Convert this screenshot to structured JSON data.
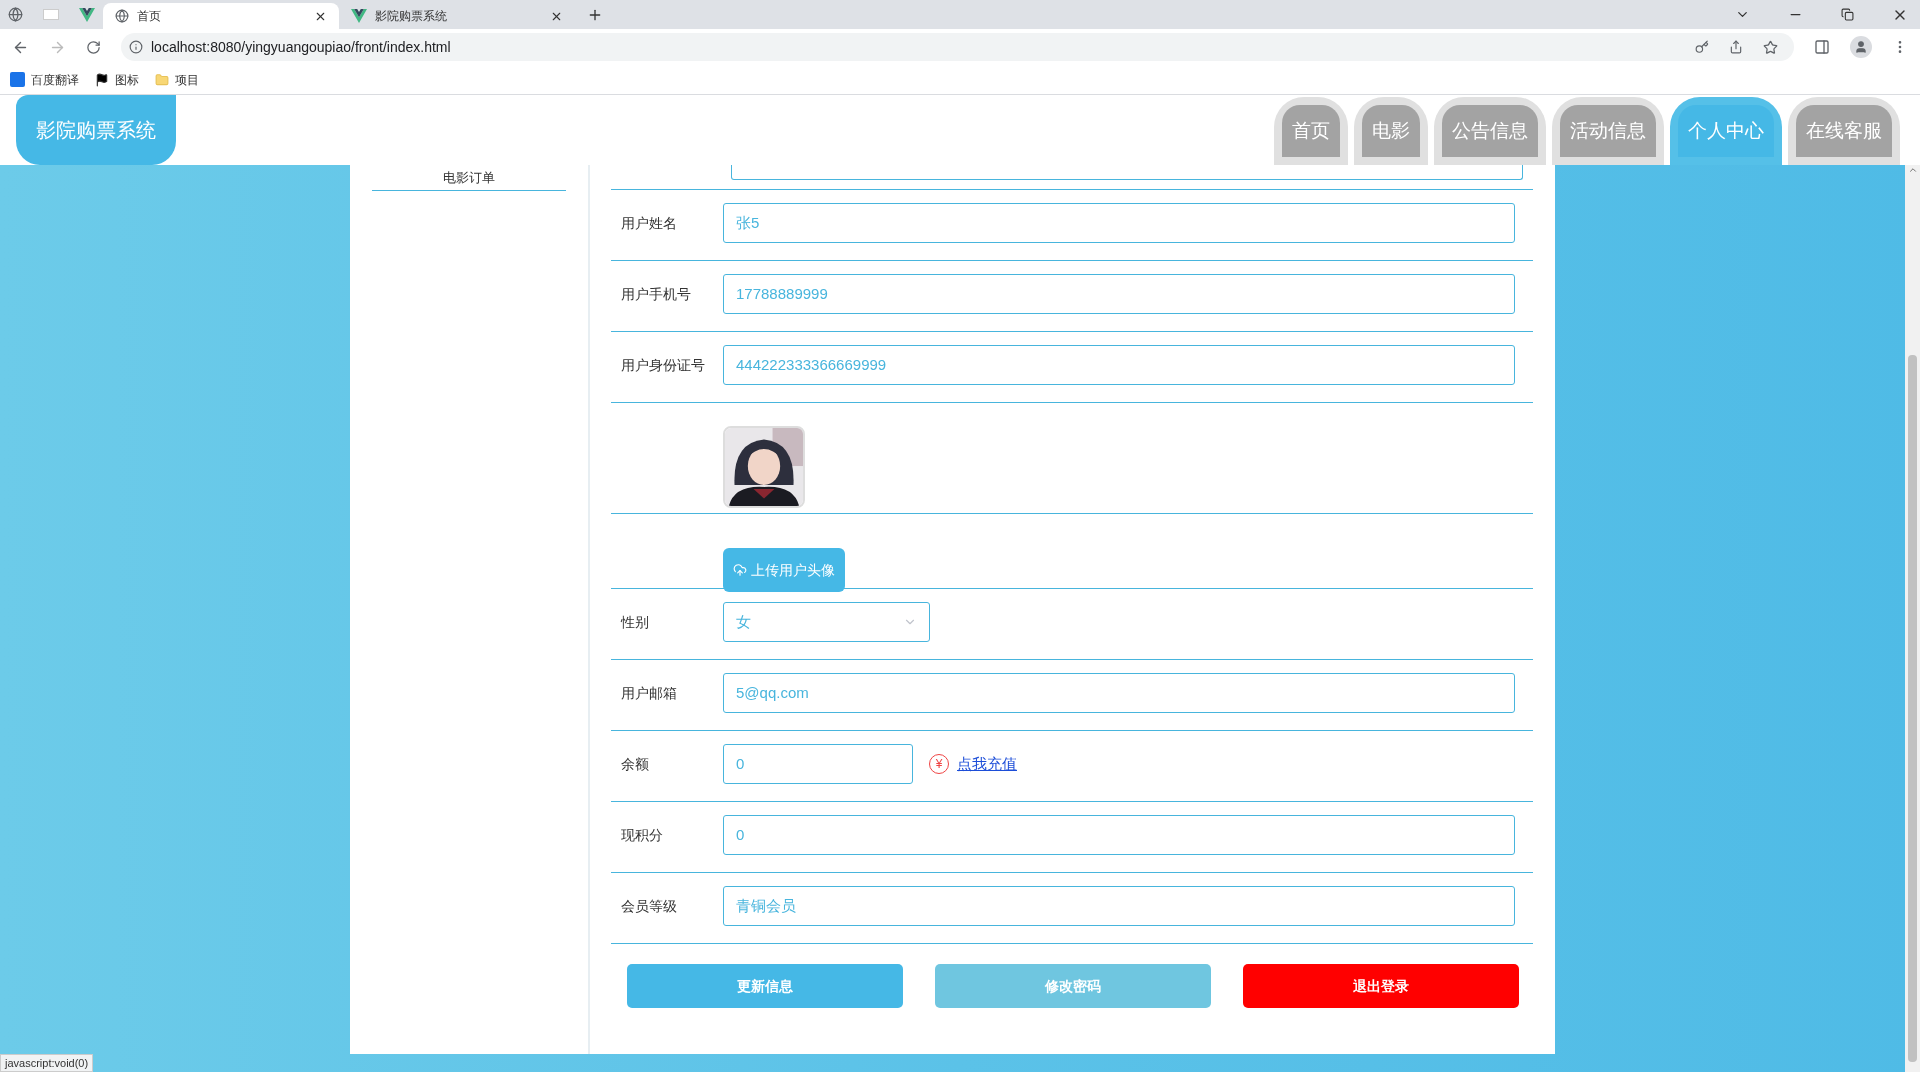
{
  "browser": {
    "tabs": [
      {
        "title": "首页",
        "selected": true
      },
      {
        "title": "影院购票系统",
        "selected": false
      }
    ],
    "url": "localhost:8080/yingyuangoupiao/front/index.html",
    "bookmarks": [
      {
        "label": "百度翻译",
        "kind": "translate"
      },
      {
        "label": "图标",
        "kind": "flag"
      },
      {
        "label": "项目",
        "kind": "folder"
      }
    ]
  },
  "header": {
    "logo": "影院购票系统",
    "nav": [
      {
        "label": "首页",
        "selected": false
      },
      {
        "label": "电影",
        "selected": false
      },
      {
        "label": "公告信息",
        "selected": false
      },
      {
        "label": "活动信息",
        "selected": false
      },
      {
        "label": "个人中心",
        "selected": true
      },
      {
        "label": "在线客服",
        "selected": false
      }
    ]
  },
  "sidebar": {
    "items": [
      "电影订单"
    ]
  },
  "form": {
    "fields": [
      {
        "kind": "text",
        "label": "用户姓名",
        "value": "张5"
      },
      {
        "kind": "text",
        "label": "用户手机号",
        "value": "17788889999"
      },
      {
        "kind": "text",
        "label": "用户身份证号",
        "value": "444222333366669999"
      },
      {
        "kind": "avatar"
      },
      {
        "kind": "upload",
        "button": "上传用户头像"
      },
      {
        "kind": "select",
        "label": "性别",
        "value": "女"
      },
      {
        "kind": "text",
        "label": "用户邮箱",
        "value": "5@qq.com"
      },
      {
        "kind": "balance",
        "label": "余额",
        "value": "0",
        "currency": "¥",
        "link": "点我充值"
      },
      {
        "kind": "text",
        "label": "现积分",
        "value": "0"
      },
      {
        "kind": "text",
        "label": "会员等级",
        "value": "青铜会员"
      }
    ],
    "buttons": [
      {
        "label": "更新信息",
        "kind": "primary"
      },
      {
        "label": "修改密码",
        "kind": "secondary"
      },
      {
        "label": "退出登录",
        "kind": "danger"
      }
    ]
  },
  "status_text": "javascript:void(0)"
}
